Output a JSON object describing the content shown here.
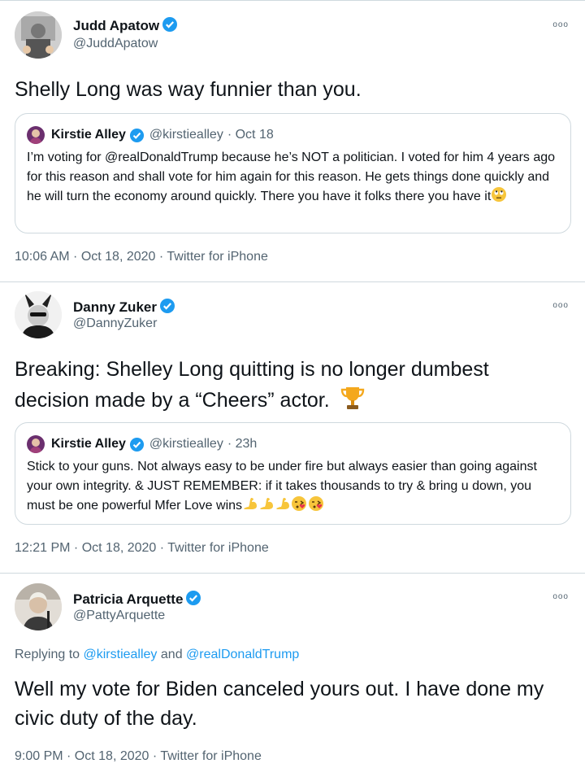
{
  "tweets": [
    {
      "name": "Judd Apatow",
      "handle": "@JuddApatow",
      "more": "ooo",
      "text": "Shelly Long was way funnier than you.",
      "quote": {
        "name": "Kirstie Alley",
        "handle": "@kirstiealley",
        "time": "· Oct 18",
        "text": "I’m voting for @realDonaldTrump because he’s NOT a politician. I voted for him 4 years ago for this reason and shall vote for him again for this reason. He gets things done quickly and he will turn the economy around quickly. There you have it folks there you have it"
      },
      "meta": "10:06 AM · Oct 18, 2020 · Twitter for iPhone"
    },
    {
      "name": "Danny Zuker",
      "handle": "@DannyZuker",
      "more": "ooo",
      "text": "Breaking: Shelley Long quitting is no longer dumbest decision made by a “Cheers” actor.",
      "quote": {
        "name": "Kirstie Alley",
        "handle": "@kirstiealley",
        "time": "· 23h",
        "text": "Stick to your guns. Not always easy to be under fire but always easier than going against your own integrity. & JUST REMEMBER: if it takes thousands to try & bring u down, you must be one powerful Mfer  Love wins"
      },
      "meta": "12:21 PM · Oct 18, 2020 · Twitter for iPhone"
    },
    {
      "name": "Patricia Arquette",
      "handle": "@PattyArquette",
      "more": "ooo",
      "reply_prefix": "Replying to",
      "reply_user1": "@kirstiealley",
      "reply_and": "and",
      "reply_user2": "@realDonaldTrump",
      "text": "Well my vote for Biden canceled yours out. I have done my civic duty of the day.",
      "meta": "9:00 PM · Oct 18, 2020 · Twitter for iPhone"
    }
  ],
  "colors": {
    "accent": "#1d9bf0",
    "secondary": "#536471",
    "border": "#cfd9de"
  },
  "icons": [
    "verified-badge-icon",
    "more-options-icon",
    "rolling-eyes-emoji",
    "trophy-emoji",
    "flexed-biceps-emoji",
    "face-blowing-kiss-emoji"
  ]
}
